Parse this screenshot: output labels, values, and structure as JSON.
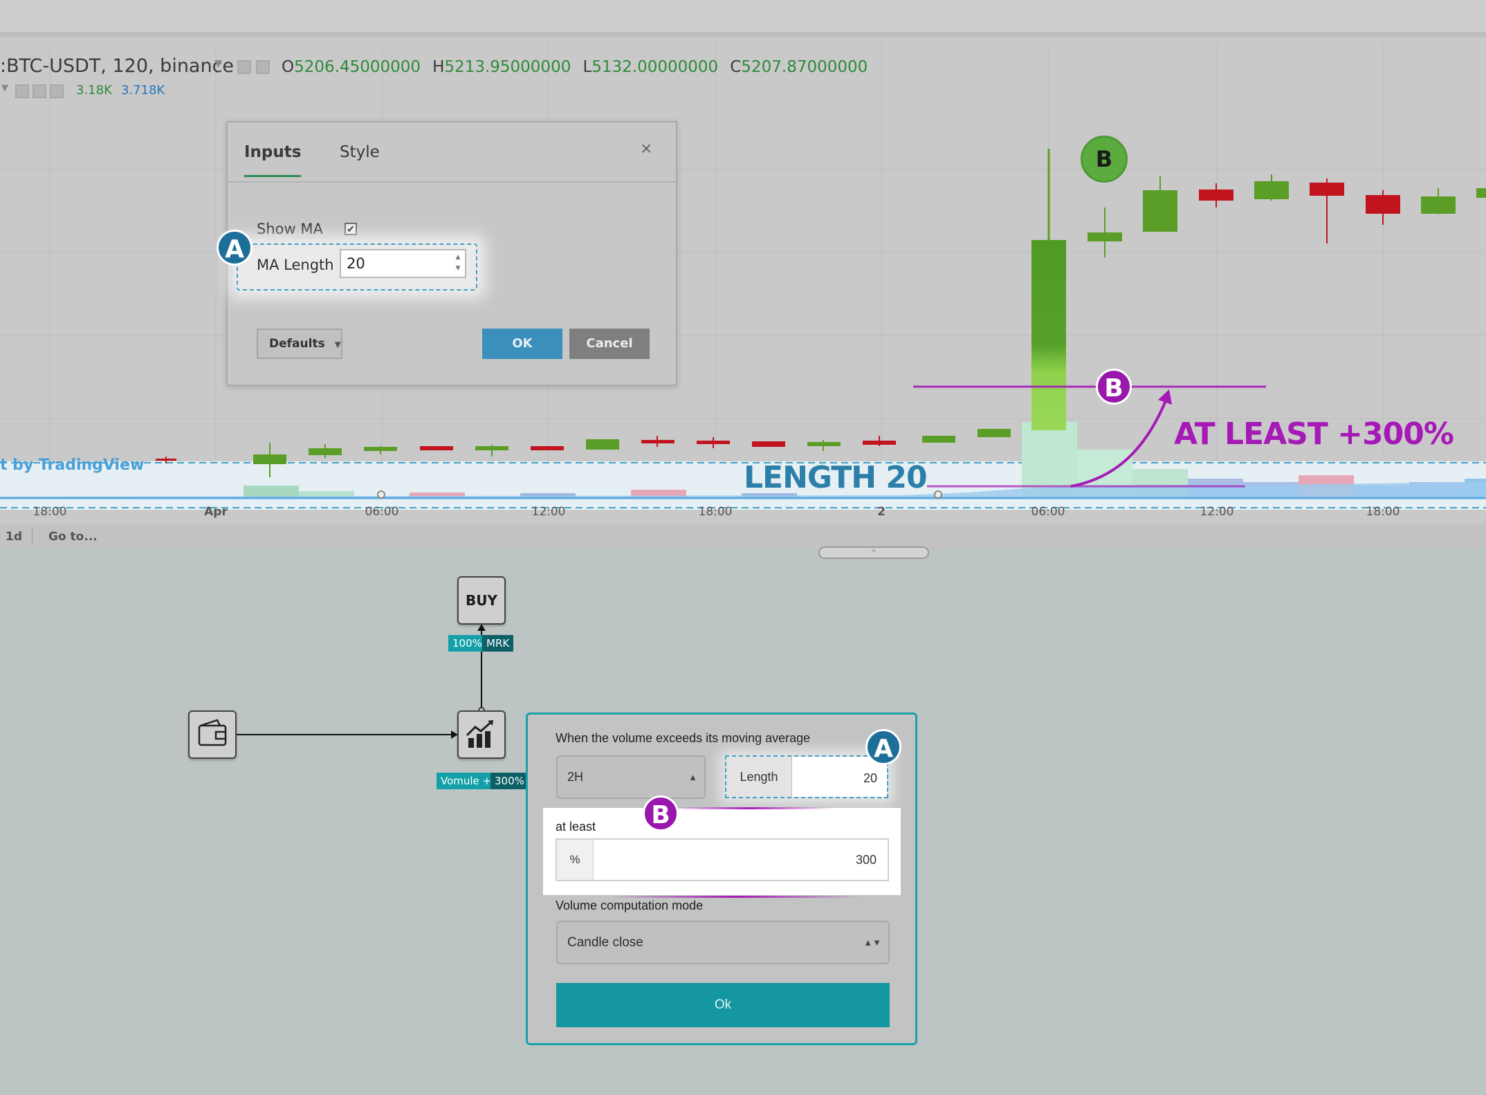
{
  "chart": {
    "symbol": ":BTC-USDT, 120, binance",
    "ohlc": {
      "o_label": "O",
      "o_value": "5206.45000000",
      "h_label": "H",
      "h_value": "5213.95000000",
      "l_label": "L",
      "l_value": "5132.00000000",
      "c_label": "C",
      "c_value": "5207.87000000"
    },
    "volume_values": [
      "3.18K",
      "3.718K"
    ],
    "watermark": "t by TradingView",
    "x_ticks": [
      "18:00",
      "Apr",
      "06:00",
      "12:00",
      "18:00",
      "2",
      "06:00",
      "12:00",
      "18:00"
    ],
    "toolbar": {
      "range": "1d",
      "goto": "Go to..."
    },
    "handle_glyph": "^",
    "badge_top": "B",
    "colors": {
      "up": "#5a9e27",
      "down": "#c2141f",
      "annotation_a": "#2c7fa8",
      "annotation_b": "#a51ab6"
    }
  },
  "annotations": {
    "length_label": "LENGTH 20",
    "atleast_label": "AT LEAST +300%",
    "badge_a": "A",
    "badge_b": "B"
  },
  "tv_dialog": {
    "tabs": [
      "Inputs",
      "Style"
    ],
    "close_glyph": "×",
    "show_ma_label": "Show MA",
    "show_ma_checked": "✔",
    "ma_length_label": "MA Length",
    "ma_length_value": "20",
    "defaults_label": "Defaults",
    "ok_label": "OK",
    "cancel_label": "Cancel"
  },
  "flow": {
    "buy_label": "BUY",
    "buy_tag_percent": "100%",
    "buy_tag_type": "MRK",
    "volume_tag_label": "Vomule +",
    "volume_tag_value": "300%"
  },
  "condition": {
    "title": "When the volume exceeds its moving average",
    "timeframe": "2H",
    "length_label": "Length",
    "length_value": "20",
    "at_least_label": "at least",
    "percent_symbol": "%",
    "percent_value": "300",
    "mode_label": "Volume computation mode",
    "mode_value": "Candle close",
    "ok_label": "Ok"
  }
}
